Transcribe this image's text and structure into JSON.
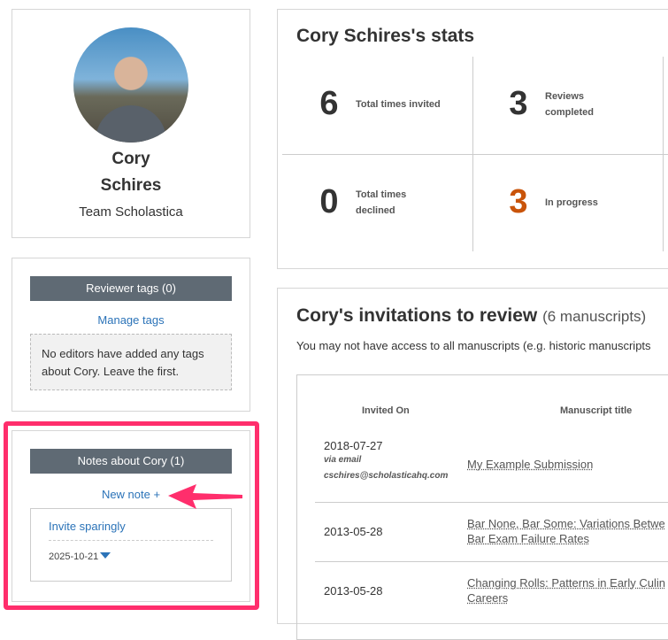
{
  "profile": {
    "first_name": "Cory",
    "last_name": "Schires",
    "team": "Team Scholastica"
  },
  "tags": {
    "header": "Reviewer tags (0)",
    "manage_link": "Manage tags",
    "empty_text": "No editors have added any tags about Cory. Leave the first."
  },
  "notes": {
    "header": "Notes about Cory (1)",
    "new_note_link": "New note +",
    "items": [
      {
        "title": "Invite sparingly",
        "date": "2025-10-21"
      }
    ]
  },
  "stats": {
    "title": "Cory Schires's stats",
    "items": [
      {
        "value": "6",
        "label": "Total times invited"
      },
      {
        "value": "3",
        "label": "Reviews completed"
      },
      {
        "value": "0",
        "label": "Total times declined"
      },
      {
        "value": "3",
        "label": "In progress",
        "color": "#c9540a"
      }
    ]
  },
  "invitations": {
    "title": "Cory's invitations to review",
    "count": "(6 manuscripts)",
    "note": "You may not have access to all manuscripts (e.g. historic manuscripts",
    "columns": [
      "Invited On",
      "Manuscript title"
    ],
    "rows": [
      {
        "date": "2018-07-27",
        "via": "via email",
        "email": "cschires@scholasticahq.com",
        "title": "My Example Submission"
      },
      {
        "date": "2013-05-28",
        "title": "Bar None, Bar Some: Variations Betwe",
        "title2": "Bar Exam Failure Rates"
      },
      {
        "date": "2013-05-28",
        "title": "Changing Rolls: Patterns in Early Culin",
        "title2": "Careers"
      }
    ]
  }
}
